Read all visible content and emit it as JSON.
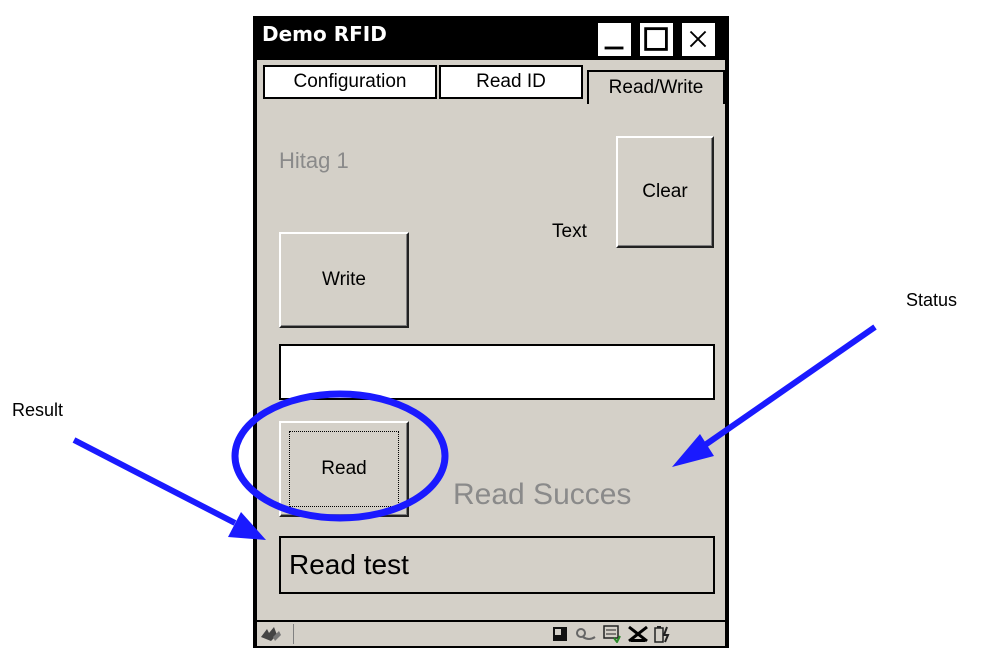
{
  "window": {
    "title": "Demo RFID",
    "minimize_label": "_",
    "close_label": "×"
  },
  "tabs": [
    {
      "label": "Configuration",
      "active": false
    },
    {
      "label": "Read ID",
      "active": false
    },
    {
      "label": "Read/Write",
      "active": true
    }
  ],
  "readwrite": {
    "tag_type": "Hitag 1",
    "clear_label": "Clear",
    "text_label": "Text",
    "write_label": "Write",
    "write_input_value": "",
    "read_label": "Read",
    "status_text": "Read Succes",
    "result_text": "Read test"
  },
  "annotations": {
    "status": "Status",
    "result": "Result",
    "arrow_color": "#1a1aff",
    "circle_color": "#1a1aff"
  },
  "taskbar": {
    "icons": [
      "start-icon",
      "pda-icon",
      "sync-icon",
      "keyboard-icon",
      "network-off-icon",
      "battery-icon"
    ]
  },
  "colors": {
    "window_bg": "#d4d0c8",
    "titlebar": "#000000",
    "status_text": "#8a8a8a"
  }
}
